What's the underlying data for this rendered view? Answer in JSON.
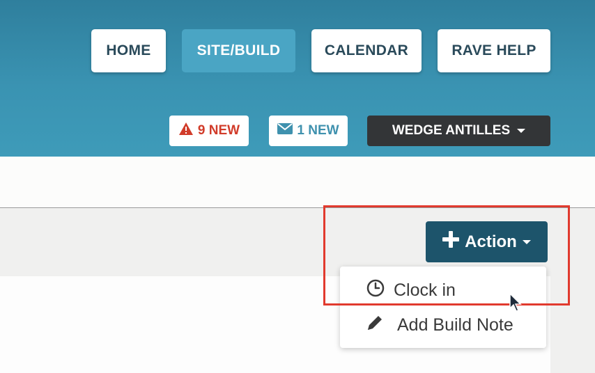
{
  "nav": {
    "home": "HOME",
    "site_build": "SITE/BUILD",
    "calendar": "CALENDAR",
    "rave_help": "RAVE HELP"
  },
  "badges": {
    "alerts": "9 NEW",
    "messages": "1 NEW"
  },
  "user": {
    "name": "WEDGE ANTILLES"
  },
  "action": {
    "label": "Action",
    "menu": {
      "clock_in": "Clock in",
      "add_build_note": "Add Build Note"
    }
  },
  "colors": {
    "header": "#3a93b2",
    "active_nav": "#4aa5c4",
    "action_button": "#1d546b",
    "alert": "#d13c2a",
    "highlight": "#e13a2e"
  },
  "icons": {
    "alert": "warning-triangle-icon",
    "mail": "envelope-icon",
    "action": "plus-icon",
    "clock_in": "clock-icon",
    "build_note": "pencil-icon"
  }
}
